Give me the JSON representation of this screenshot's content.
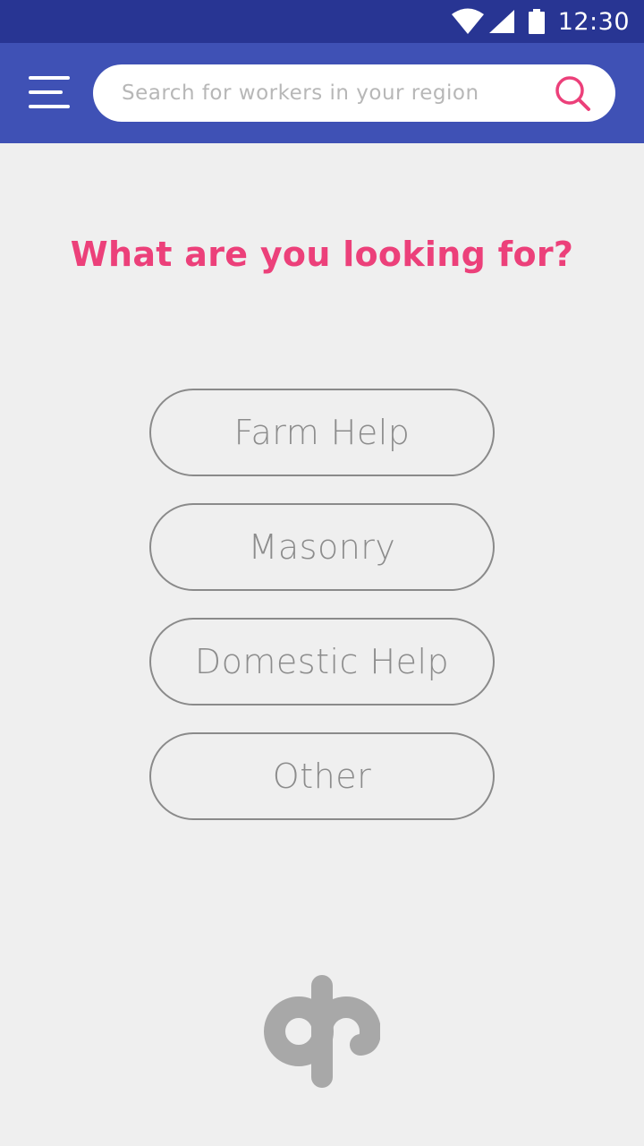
{
  "status_bar": {
    "time": "12:30",
    "icons": [
      "wifi-icon",
      "signal-icon",
      "battery-icon"
    ],
    "background": "#283593"
  },
  "app_bar": {
    "background": "#3f51b5",
    "menu_icon": "hamburger-menu-icon",
    "search": {
      "placeholder": "Search for workers in your region",
      "value": "",
      "icon": "search-icon"
    }
  },
  "main": {
    "heading": "What are you looking for?",
    "options": [
      {
        "label": "Farm Help"
      },
      {
        "label": "Masonry"
      },
      {
        "label": "Domestic Help"
      },
      {
        "label": "Other"
      }
    ]
  },
  "logo": {
    "icon": "app-logo-icon"
  },
  "colors": {
    "accent": "#ec407a",
    "background": "#efefef",
    "button_border": "#8a8a8a",
    "logo": "#a8a8a8"
  }
}
